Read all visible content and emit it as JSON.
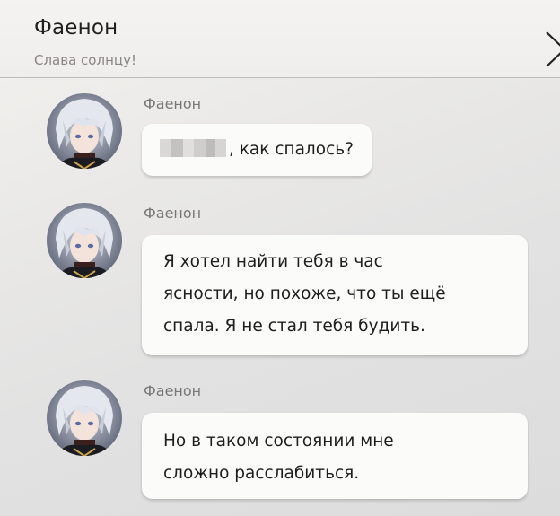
{
  "header": {
    "title": "Фаенон",
    "subtitle": "Слава солнцу!"
  },
  "messages": [
    {
      "sender": "Фаенон",
      "text": ", как спалось?",
      "redacted_prefix": true
    },
    {
      "sender": "Фаенон",
      "lines": [
        "Я хотел найти тебя в час",
        "ясности, но похоже, что ты ещё",
        "спала. Я не стал тебя будить."
      ]
    },
    {
      "sender": "Фаенон",
      "lines": [
        "Но в таком состоянии мне",
        "сложно расслабиться."
      ]
    }
  ],
  "icons": {
    "close": "close-icon",
    "avatar": "avatar"
  },
  "colors": {
    "background": "#e6e6e5",
    "bubble": "#fbfbfa",
    "sender_name": "#7a7876",
    "subtitle": "#8a8684"
  }
}
